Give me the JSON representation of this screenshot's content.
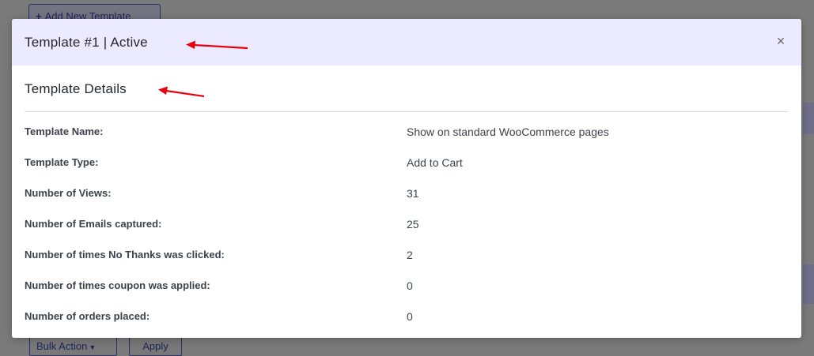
{
  "background": {
    "add_button_label": "Add New Template",
    "bulk_action_label": "Bulk Action",
    "apply_label": "Apply"
  },
  "modal": {
    "title": "Template #1 | Active",
    "close_symbol": "×",
    "section_title": "Template Details",
    "details": [
      {
        "label": "Template Name:",
        "value": "Show on standard WooCommerce pages"
      },
      {
        "label": "Template Type:",
        "value": "Add to Cart"
      },
      {
        "label": "Number of Views:",
        "value": "31"
      },
      {
        "label": "Number of Emails captured:",
        "value": "25"
      },
      {
        "label": "Number of times No Thanks was clicked:",
        "value": "2"
      },
      {
        "label": "Number of times coupon was applied:",
        "value": "0"
      },
      {
        "label": "Number of orders placed:",
        "value": "0"
      }
    ]
  },
  "colors": {
    "header_bg": "#eceaff",
    "annotation_arrow": "#e8000b",
    "overlay": "#7a7a7a"
  },
  "icons": {
    "close": "close-icon",
    "plus": "plus-icon",
    "caret": "caret-down-icon",
    "arrow": "red-arrow-annotation"
  }
}
